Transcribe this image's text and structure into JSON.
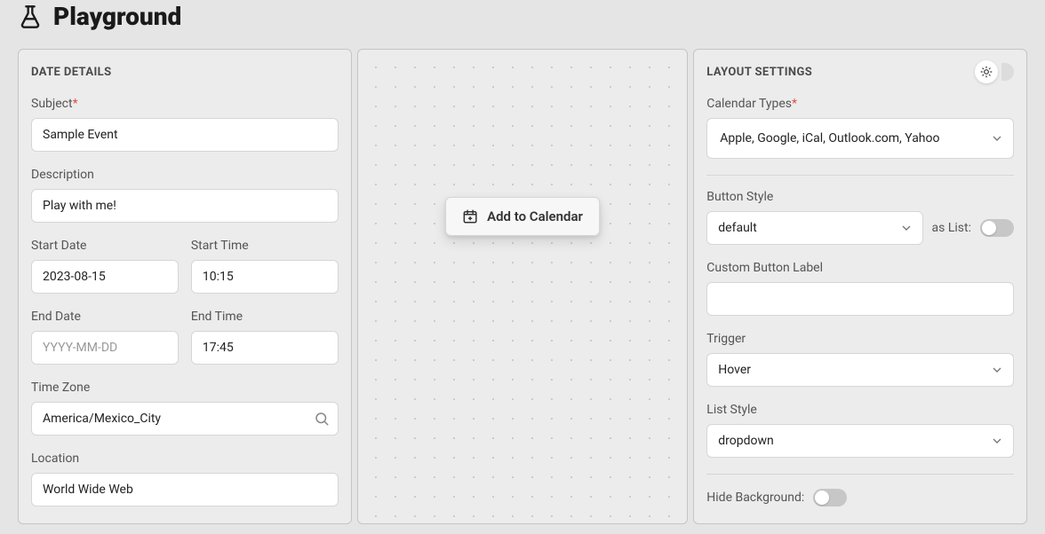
{
  "header": {
    "title": "Playground"
  },
  "left": {
    "section_title": "DATE DETAILS",
    "subject_label": "Subject",
    "subject_value": "Sample Event",
    "description_label": "Description",
    "description_value": "Play with me!",
    "start_date_label": "Start Date",
    "start_date_value": "2023-08-15",
    "start_time_label": "Start Time",
    "start_time_value": "10:15",
    "end_date_label": "End Date",
    "end_date_value": "",
    "end_date_placeholder": "YYYY-MM-DD",
    "end_time_label": "End Time",
    "end_time_value": "17:45",
    "timezone_label": "Time Zone",
    "timezone_value": "America/Mexico_City",
    "location_label": "Location",
    "location_value": "World Wide Web"
  },
  "center": {
    "button_label": "Add to Calendar"
  },
  "right": {
    "section_title": "LAYOUT SETTINGS",
    "calendar_types_label": "Calendar Types",
    "calendar_types_value": "Apple, Google, iCal, Outlook.com, Yahoo",
    "button_style_label": "Button Style",
    "button_style_value": "default",
    "as_list_label": "as List:",
    "custom_label_label": "Custom Button Label",
    "custom_label_value": "",
    "trigger_label": "Trigger",
    "trigger_value": "Hover",
    "list_style_label": "List Style",
    "list_style_value": "dropdown",
    "hide_bg_label": "Hide Background:"
  }
}
